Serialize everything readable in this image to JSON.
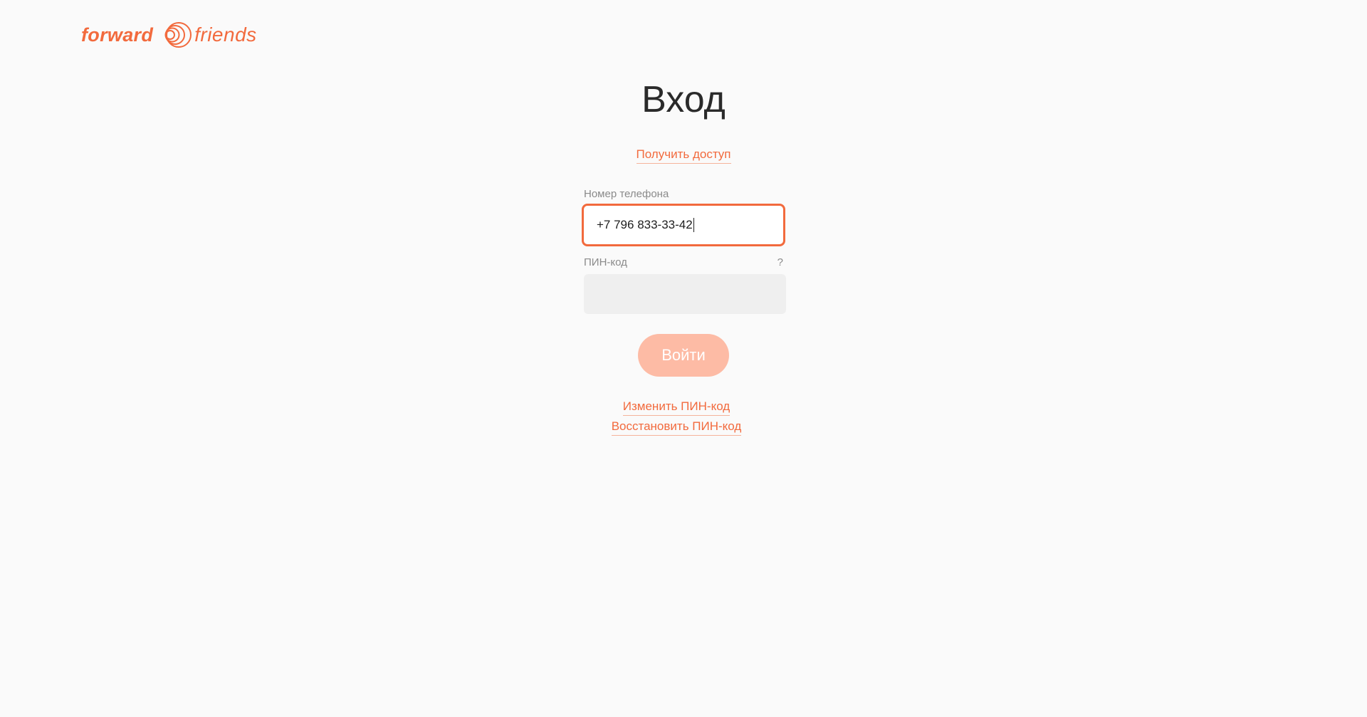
{
  "logo": {
    "word_left": "forward",
    "word_right": "friends",
    "mark_icon": "concentric-circles-logo-icon",
    "brand_color": "#f26a3d"
  },
  "login": {
    "title": "Вход",
    "get_access_link": "Получить доступ",
    "phone_label": "Номер телефона",
    "phone_value": "+7 796 833-33-42",
    "pin_label": "ПИН-код",
    "pin_help": "?",
    "pin_value": "",
    "submit_label": "Войти",
    "change_pin_link": "Изменить ПИН-код",
    "restore_pin_link": "Восстановить ПИН-код"
  },
  "colors": {
    "accent": "#f26a3d",
    "button_disabled": "#fdbba5",
    "background": "#fafafa",
    "input_bg": "#efefef"
  }
}
